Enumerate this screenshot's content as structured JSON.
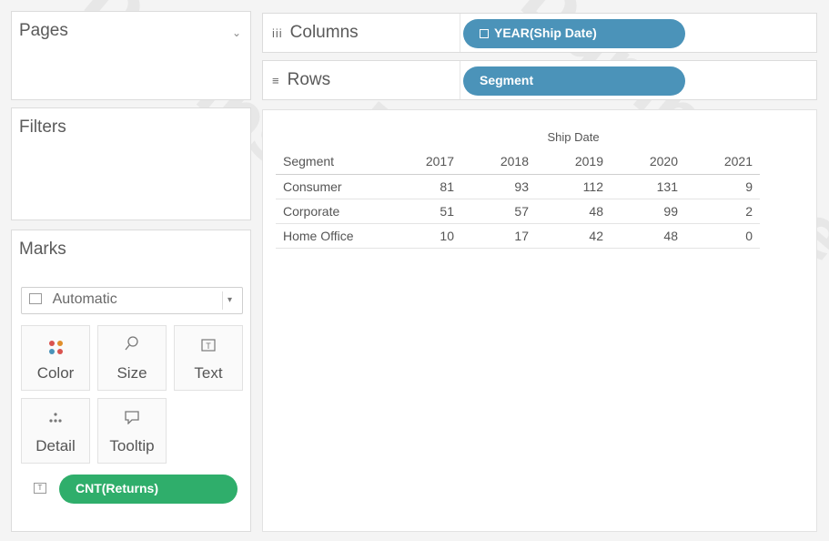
{
  "left": {
    "pages_title": "Pages",
    "filters_title": "Filters",
    "marks_title": "Marks",
    "mark_type": "Automatic",
    "mark_buttons": [
      {
        "label": "Color",
        "icon": "color-dots-icon"
      },
      {
        "label": "Size",
        "icon": "size-icon"
      },
      {
        "label": "Text",
        "icon": "text-icon"
      },
      {
        "label": "Detail",
        "icon": "detail-icon"
      },
      {
        "label": "Tooltip",
        "icon": "tooltip-icon"
      }
    ],
    "mark_pill": "CNT(Returns)"
  },
  "shelves": {
    "columns_label": "Columns",
    "columns_pill": "YEAR(Ship Date)",
    "rows_label": "Rows",
    "rows_pill": "Segment"
  },
  "crosstab": {
    "column_title": "Ship Date",
    "row_header": "Segment",
    "years": [
      "2017",
      "2018",
      "2019",
      "2020",
      "2021"
    ],
    "rows": [
      {
        "segment": "Consumer",
        "values": [
          "81",
          "93",
          "112",
          "131",
          "9"
        ]
      },
      {
        "segment": "Corporate",
        "values": [
          "51",
          "57",
          "48",
          "99",
          "2"
        ]
      },
      {
        "segment": "Home Office",
        "values": [
          "10",
          "17",
          "42",
          "48",
          "0"
        ]
      }
    ]
  },
  "colors": {
    "blue_pill": "#4b93b9",
    "green_pill": "#2fae6b"
  },
  "watermark": "DumpsQueen"
}
